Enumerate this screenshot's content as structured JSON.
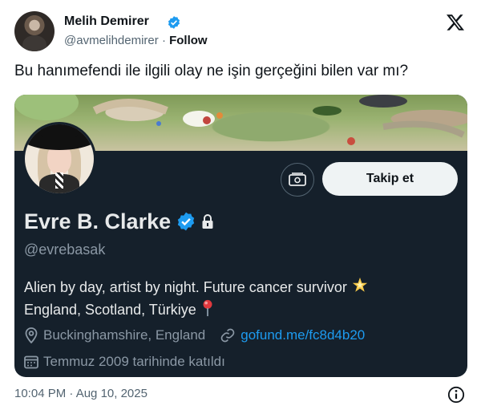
{
  "tweet": {
    "author_name": "Melih Demirer",
    "author_handle": "@avmelihdemirer",
    "separator": "·",
    "follow_label": "Follow",
    "text": "Bu hanımefendi ile ilgili olay ne işin gerçeğini bilen var mı?",
    "timestamp": "10:04 PM · Aug 10, 2025"
  },
  "profile_card": {
    "name": "Evre B. Clarke",
    "handle": "@evrebasak",
    "follow_button_label": "Takip et",
    "bio_line1": "Alien by day, artist by night. Future cancer survivor",
    "bio_line2": "England, Scotland, Türkiye",
    "location": "Buckinghamshire, England",
    "link": "gofund.me/fc8d4b20",
    "joined": "Temmuz 2009 tarihinde katıldı"
  },
  "colors": {
    "verified_blue": "#1d9bf0",
    "card_background": "#15202b",
    "link_blue": "#1d9bf0",
    "follow_button_bg": "#eff3f4"
  },
  "icons": [
    "verified-badge-icon",
    "x-logo-icon",
    "money-icon",
    "lock-icon",
    "star-emoji",
    "pin-emoji",
    "location-icon",
    "link-icon",
    "calendar-icon",
    "info-icon"
  ]
}
